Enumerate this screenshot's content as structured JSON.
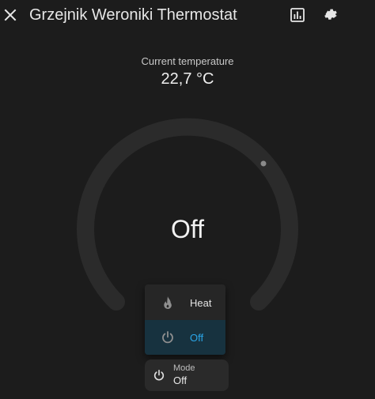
{
  "header": {
    "title": "Grzejnik Weroniki Thermostat",
    "close_icon": "close-icon",
    "history_icon": "chart-box-icon",
    "settings_icon": "gear-icon"
  },
  "current": {
    "label": "Current temperature",
    "value": "22,7 °C"
  },
  "dial": {
    "state": "Off"
  },
  "mode_menu": {
    "items": [
      {
        "label": "Heat",
        "icon": "fire-icon",
        "selected": false
      },
      {
        "label": "Off",
        "icon": "power-icon",
        "selected": true
      }
    ]
  },
  "mode_tile": {
    "label": "Mode",
    "value": "Off",
    "icon": "power-icon"
  },
  "colors": {
    "background": "#1c1c1c",
    "dial_track": "#2b2b2b",
    "accent_blue": "#2aa6e8",
    "selected_bg": "#17323f",
    "menu_bg": "#262626",
    "tile_bg": "#2a2a2a"
  }
}
